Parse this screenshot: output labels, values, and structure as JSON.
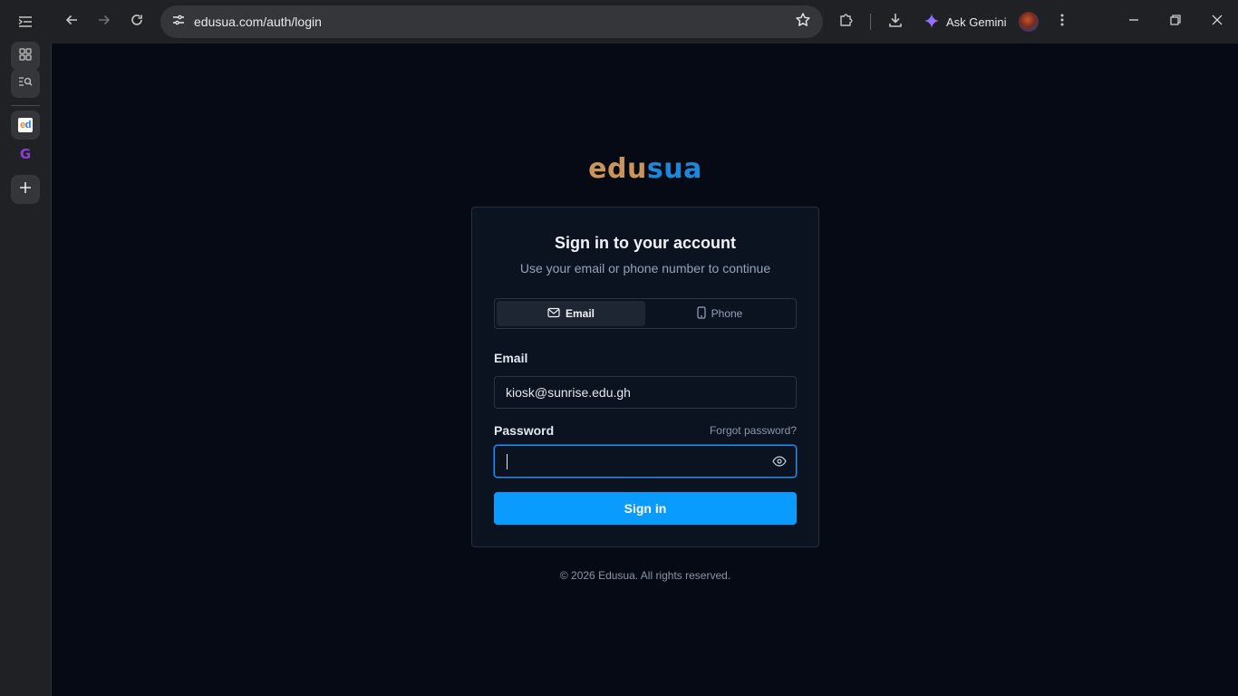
{
  "browser": {
    "url": "edusua.com/auth/login",
    "gemini_label": "Ask Gemini",
    "icons": {
      "back": "arrow-left-icon",
      "forward": "arrow-right-icon",
      "reload": "reload-icon",
      "site_info": "tune-icon",
      "bookmark": "star-icon",
      "extensions": "puzzle-icon",
      "downloads": "download-icon",
      "gemini": "gemini-spark-icon",
      "menu": "kebab-menu-icon"
    }
  },
  "side_tabs": {
    "items": [
      {
        "name": "tab-groups",
        "icon": "grid-icon"
      },
      {
        "name": "tab-search",
        "icon": "tab-search-icon"
      },
      {
        "name": "edusua",
        "icon": "edusua-favicon",
        "favicon_text_1": "e",
        "favicon_text_2": "d"
      },
      {
        "name": "grammarly",
        "icon": "g-favicon",
        "favicon_text": "G"
      },
      {
        "name": "new-tab",
        "icon": "plus-icon"
      }
    ]
  },
  "page": {
    "logo_part1": "edu",
    "logo_part2": "sua",
    "card": {
      "title": "Sign in to your account",
      "subtitle": "Use your email or phone number to continue",
      "tabs": [
        {
          "label": "Email",
          "icon": "mail-icon",
          "active": true
        },
        {
          "label": "Phone",
          "icon": "phone-icon",
          "active": false
        }
      ],
      "email_label": "Email",
      "email_value": "kiosk@sunrise.edu.gh",
      "password_label": "Password",
      "forgot_label": "Forgot password?",
      "password_value": "",
      "submit_label": "Sign in"
    },
    "footer": "© 2026 Edusua. All rights reserved."
  },
  "colors": {
    "page_bg": "#060a14",
    "card_bg": "#0b1220",
    "accent": "#0a9bff",
    "logo_edu": "#c9955a",
    "logo_sua": "#1e88d8"
  }
}
